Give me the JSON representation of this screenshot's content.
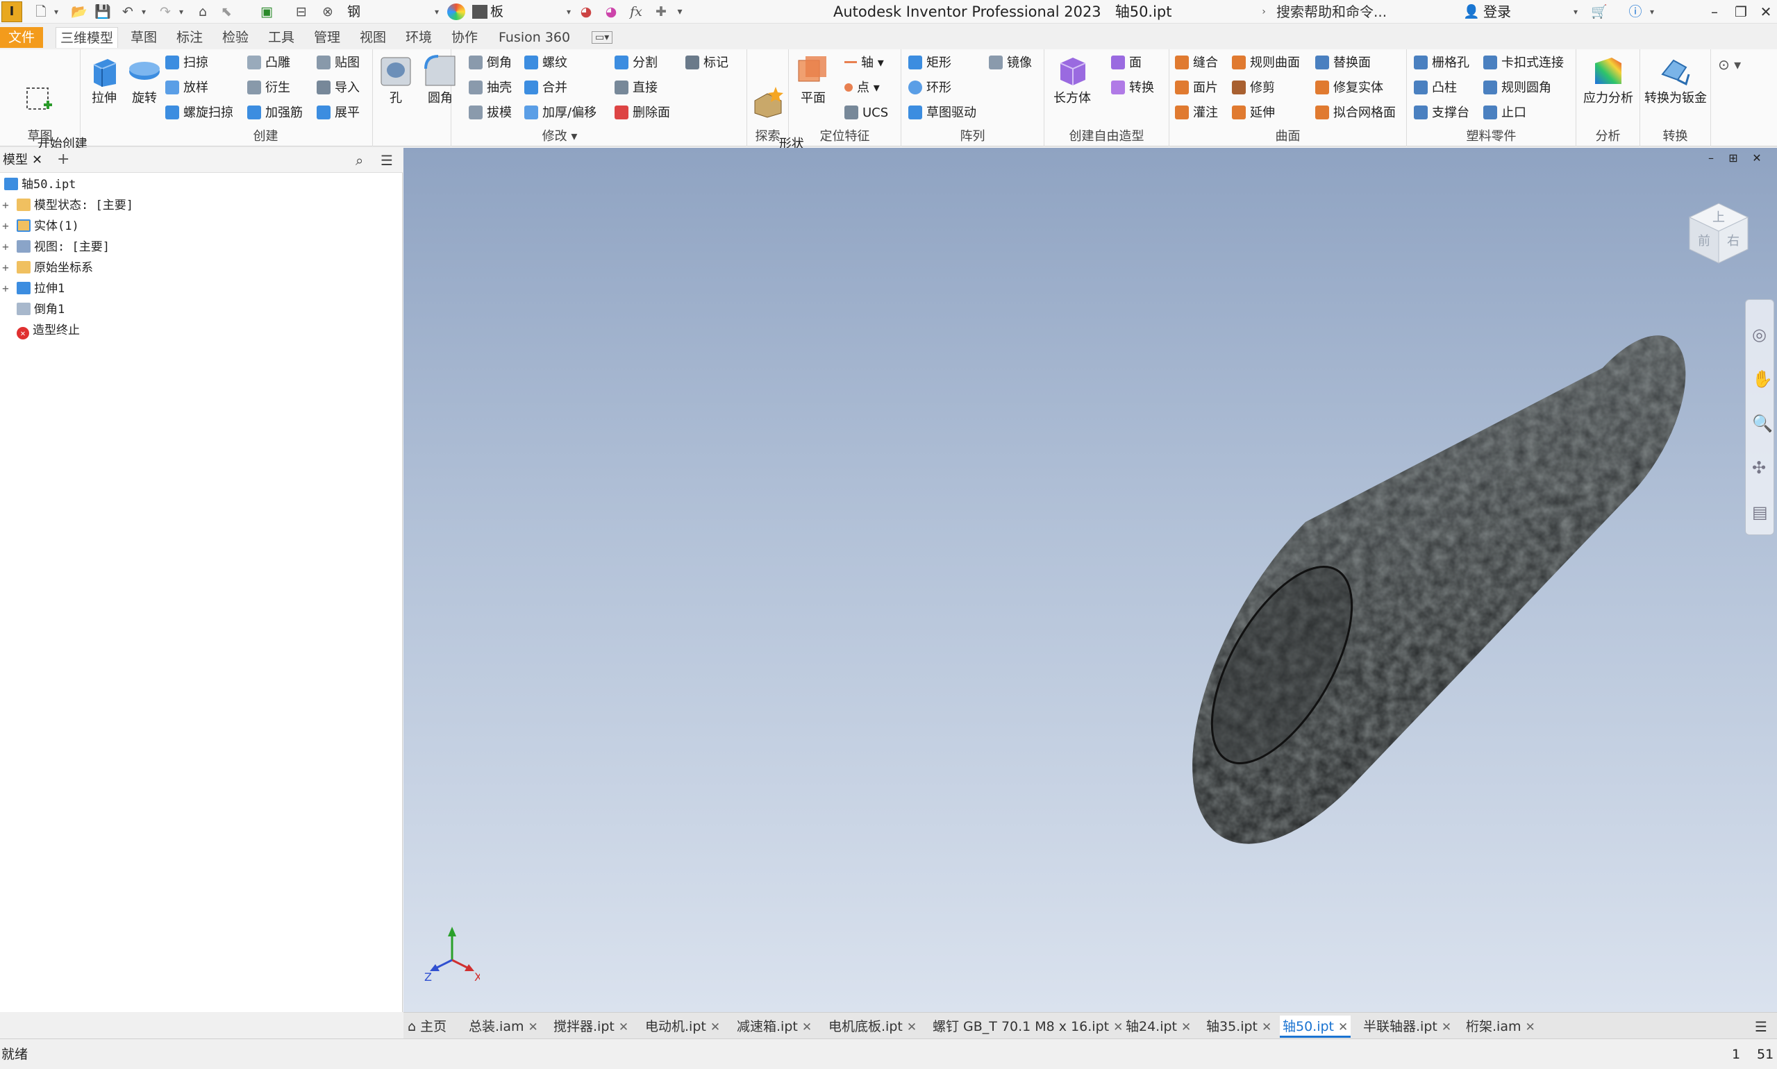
{
  "titlebar": {
    "app_logo": "I",
    "material": "钢",
    "appearance": "板",
    "app_title": "Autodesk Inventor Professional 2023",
    "document": "轴50.ipt",
    "help_search": "搜索帮助和命令...",
    "login": "登录"
  },
  "ribbon_tabs": [
    "文件",
    "三维模型",
    "草图",
    "标注",
    "检验",
    "工具",
    "管理",
    "视图",
    "环境",
    "协作",
    "Fusion 360"
  ],
  "ribbon": {
    "sketch": {
      "title": "草图",
      "start_sketch": "开始创建\n二维草图"
    },
    "create": {
      "title": "创建",
      "extrude": "拉伸",
      "revolve": "旋转",
      "sweep": "扫掠",
      "loft": "放样",
      "coil": "螺旋扫掠",
      "emboss": "凸雕",
      "derive": "衍生",
      "rib": "加强筋",
      "decal": "贴图",
      "import": "导入",
      "unfold": "展平"
    },
    "modify": {
      "title": "修改",
      "hole": "孔",
      "fillet": "圆角",
      "chamfer": "倒角",
      "shell": "抽壳",
      "draft": "拔模",
      "thread": "螺纹",
      "combine": "合并",
      "thicken": "加厚/偏移",
      "split": "分割",
      "direct": "直接",
      "delete_face": "删除面",
      "mark": "标记"
    },
    "explore": {
      "title": "探索",
      "shape_gen": "形状\n生成器"
    },
    "work_features": {
      "title": "定位特征",
      "plane": "平面",
      "axis": "轴",
      "point": "点",
      "ucs": "UCS"
    },
    "pattern": {
      "title": "阵列",
      "rect": "矩形",
      "circ": "环形",
      "sketch_driven": "草图驱动",
      "mirror": "镜像"
    },
    "freeform": {
      "title": "创建自由造型",
      "box": "长方体",
      "face": "面",
      "convert": "转换"
    },
    "surface": {
      "title": "曲面",
      "stitch": "缝合",
      "patch": "面片",
      "sculpt": "灌注",
      "ruled": "规则曲面",
      "trim": "修剪",
      "extend": "延伸",
      "replace": "替换面",
      "repair": "修复实体",
      "fit_mesh": "拟合网格面"
    },
    "plastic": {
      "title": "塑料零件",
      "grill": "栅格孔",
      "boss": "凸柱",
      "rest": "支撑台",
      "snap": "卡扣式连接",
      "rule_fillet": "规则圆角",
      "lip": "止口"
    },
    "analysis": {
      "title": "分析",
      "stress": "应力分析"
    },
    "convert": {
      "title": "转换",
      "to_sheet": "转换为钣金"
    }
  },
  "browser": {
    "tab_label": "模型",
    "tree": [
      {
        "label": "轴50.ipt",
        "expander": ""
      },
      {
        "label": "模型状态: [主要]",
        "expander": "+"
      },
      {
        "label": "实体(1)",
        "expander": "+"
      },
      {
        "label": "视图: [主要]",
        "expander": "+"
      },
      {
        "label": "原始坐标系",
        "expander": "+"
      },
      {
        "label": "拉伸1",
        "expander": "+"
      },
      {
        "label": "倒角1",
        "expander": ""
      },
      {
        "label": "造型终止",
        "expander": ""
      }
    ]
  },
  "viewcube": {
    "front": "前",
    "top": "上",
    "right": "右"
  },
  "triad": {
    "x": "X",
    "y": "Y",
    "z": "Z"
  },
  "doc_tabs": [
    {
      "label": "主页"
    },
    {
      "label": "总装.iam"
    },
    {
      "label": "搅拌器.ipt"
    },
    {
      "label": "电动机.ipt"
    },
    {
      "label": "减速箱.ipt"
    },
    {
      "label": "电机底板.ipt"
    },
    {
      "label": "螺钉 GB_T 70.1 M8 x 16.ipt"
    },
    {
      "label": "轴24.ipt"
    },
    {
      "label": "轴35.ipt"
    },
    {
      "label": "轴50.ipt",
      "active": true
    },
    {
      "label": "半联轴器.ipt"
    },
    {
      "label": "桁架.iam"
    }
  ],
  "status": {
    "text": "就绪",
    "n1": "1",
    "n2": "51"
  },
  "colors": {
    "file_tab": "#f39b1c",
    "active_doc_tab": "#1a73d1",
    "viewport_top": "#8fa3c2",
    "viewport_bottom": "#dae2ee",
    "part": "#2e3233"
  }
}
